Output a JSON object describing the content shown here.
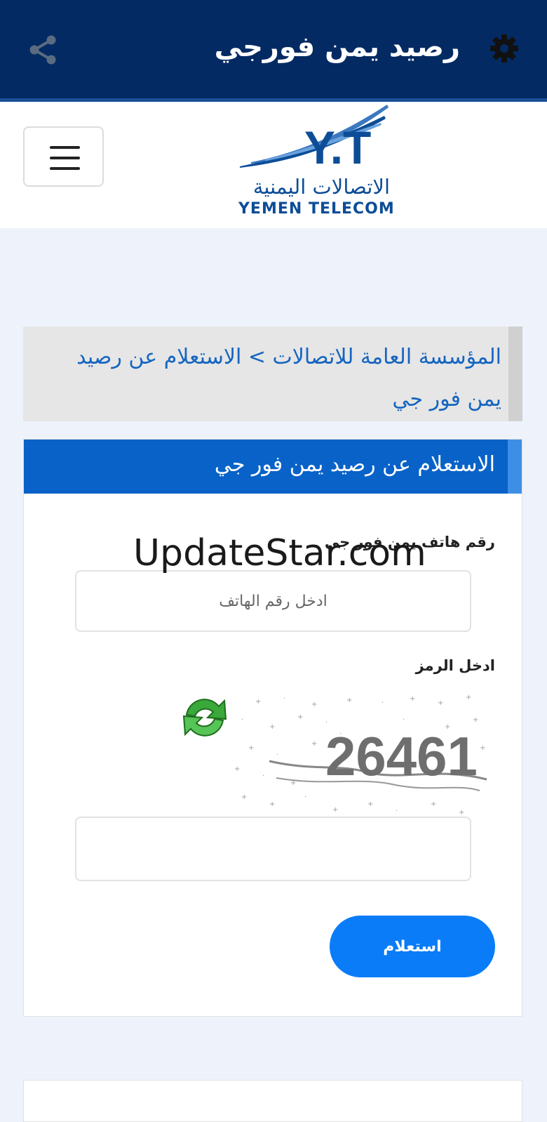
{
  "appbar": {
    "title": "رصيد يمن فورجي",
    "settings_icon": "gear-icon",
    "share_icon": "share-icon",
    "background": "#032a63"
  },
  "header": {
    "logo_mark": "Y.T",
    "logo_arabic": "الاتصالات اليمنية",
    "logo_english": "YEMEN TELECOM",
    "menu_icon": "hamburger-menu-icon"
  },
  "breadcrumb": {
    "text": "المؤسسة العامة للاتصالات > الاستعلام عن رصيد يمن فور جي"
  },
  "form": {
    "heading": "الاستعلام عن رصيد يمن فور جي",
    "phone_label": "رقم هاتف يمن فور جي",
    "phone_placeholder": "ادخل رقم الهاتف",
    "phone_value": "",
    "code_label": "ادخل الرمز",
    "captcha_text": "26461",
    "code_value": "",
    "submit_label": "استعلام",
    "refresh_icon": "refresh-icon"
  },
  "watermark": "UpdateStar.com",
  "colors": {
    "accent": "#0862c8",
    "button": "#0a7cf7",
    "link": "#1565c0"
  }
}
